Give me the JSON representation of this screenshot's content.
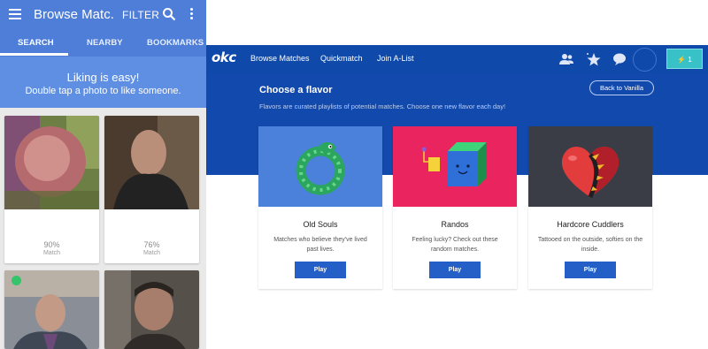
{
  "mobile": {
    "title": "Browse Matc...",
    "filter_label": "FILTER",
    "tabs": [
      {
        "label": "SEARCH"
      },
      {
        "label": "NEARBY"
      },
      {
        "label": "BOOKMARKS"
      }
    ],
    "banner": {
      "line1": "Liking is easy!",
      "line2": "Double tap a photo to like someone."
    },
    "cards": [
      {
        "percent": "90%",
        "match_label": "Match"
      },
      {
        "percent": "76%",
        "match_label": "Match"
      },
      {
        "percent": "",
        "match_label": ""
      },
      {
        "percent": "",
        "match_label": ""
      }
    ],
    "colors": {
      "appbar": "#4f7ed8",
      "banner": "#5f8fe2",
      "online": "#34c46a"
    }
  },
  "web": {
    "logo": "okc",
    "nav": [
      {
        "label": "Browse Matches"
      },
      {
        "label": "Quickmatch"
      },
      {
        "label": "Join A-List"
      }
    ],
    "icons": [
      "people-icon",
      "star-icon",
      "chat-icon"
    ],
    "boost_label": "1",
    "heading": "Choose a flavor",
    "subheading": "Flavors are curated playlists of potential matches. Choose one new flavor each day!",
    "back_button": "Back to Vanilla",
    "flavors": [
      {
        "title": "Old Souls",
        "description": "Matches who believe they've lived past lives.",
        "button": "Play",
        "color": "#4b80db"
      },
      {
        "title": "Randos",
        "description": "Feeling lucky? Check out these random matches.",
        "button": "Play",
        "color": "#e9245e"
      },
      {
        "title": "Hardcore Cuddlers",
        "description": "Tattooed on the outside, softies on the inside.",
        "button": "Play",
        "color": "#3a3d45"
      }
    ],
    "colors": {
      "nav": "#0f4aaa",
      "boost": "#38c2c8",
      "play": "#245fc8"
    }
  }
}
